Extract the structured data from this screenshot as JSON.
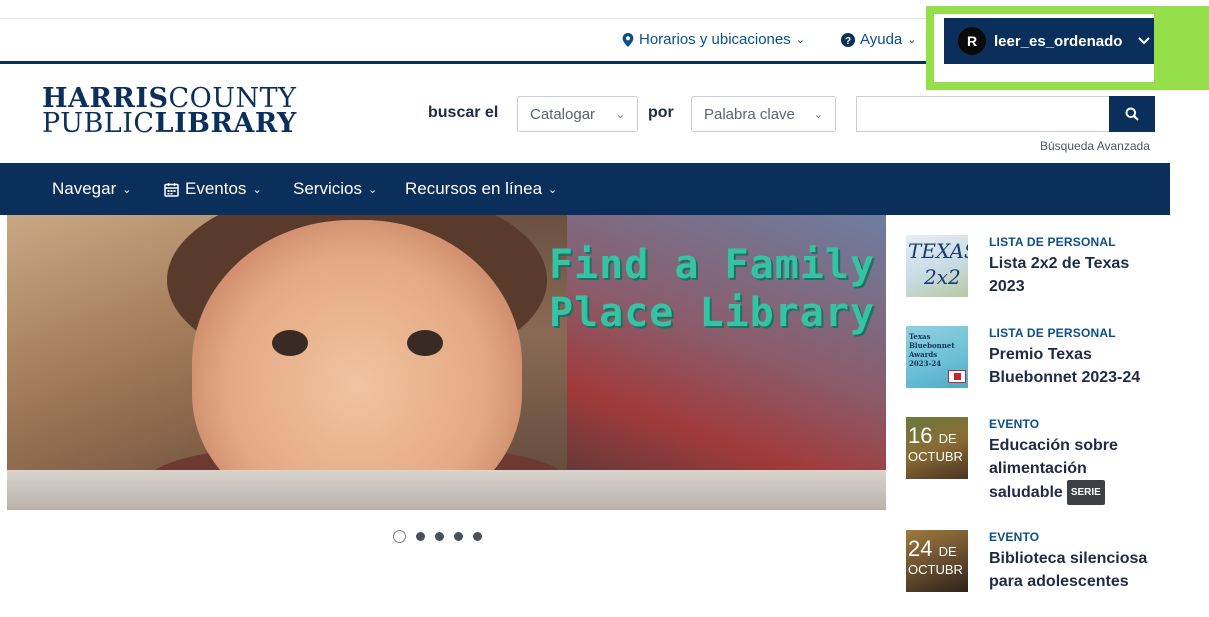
{
  "top_links": {
    "hours": "Horarios y ubicaciones",
    "help": "Ayuda"
  },
  "account": {
    "avatar_initial": "R",
    "username": "leer_es_ordenado"
  },
  "logo": {
    "line1_bold": "HARRIS",
    "line1_thin": "COUNTY",
    "line2_thin": "PUBLIC",
    "line2_bold": "LIBRARY"
  },
  "search": {
    "search_label": "buscar el",
    "scope_value": "Catalogar",
    "by_label": "por",
    "type_value": "Palabra clave",
    "query": "",
    "advanced_link": "Búsqueda Avanzada"
  },
  "nav": {
    "items": [
      "Navegar",
      "Eventos",
      "Servicios",
      "Recursos en línea"
    ]
  },
  "hero": {
    "title_line1": "Find a Family",
    "title_line2": "Place Library",
    "slide_count": 5,
    "active_slide": 1
  },
  "features": [
    {
      "category": "LISTA DE PERSONAL",
      "title": "Lista 2x2 de Texas 2023",
      "thumb_text_1": "TEXAS",
      "thumb_text_2": "2x2"
    },
    {
      "category": "LISTA DE PERSONAL",
      "title": "Premio Texas Bluebonnet 2023-24",
      "thumb_text_1": "Texas",
      "thumb_text_2": "Bluebonnet",
      "thumb_text_3": "Awards",
      "thumb_text_4": "2023-24"
    },
    {
      "category": "EVENTO",
      "title": "Educación sobre alimentación saludable",
      "badge": "SERIE",
      "day": "16",
      "day_suffix": "DE",
      "month": "OCTUBR"
    },
    {
      "category": "EVENTO",
      "title": "Biblioteca silenciosa para adolescentes",
      "day": "24",
      "day_suffix": "DE",
      "month": "OCTUBR"
    }
  ],
  "colors": {
    "brand_navy": "#0b2f5b",
    "link_blue": "#0b4f8a",
    "highlight_green": "#95e04a",
    "hero_title_teal": "#36c3a4"
  }
}
